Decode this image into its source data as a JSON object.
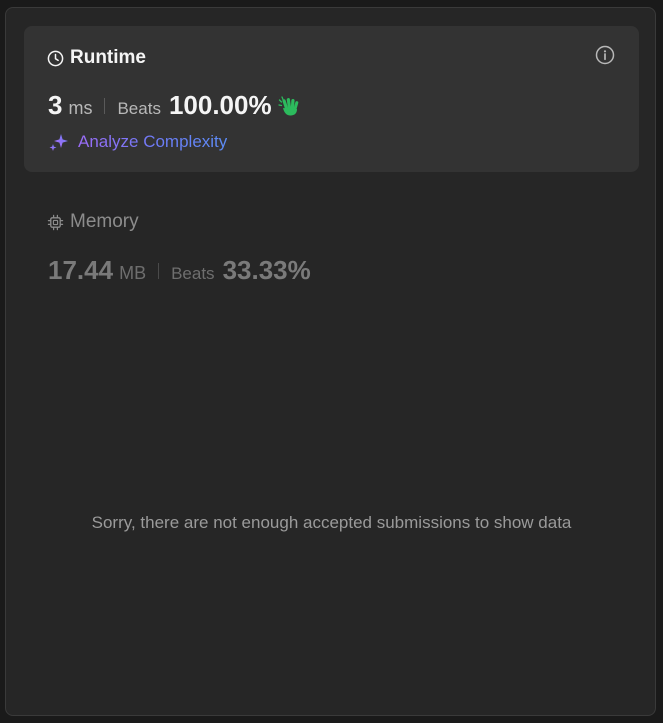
{
  "runtime": {
    "title": "Runtime",
    "value": "3",
    "unit": "ms",
    "beats_label": "Beats",
    "beats_value": "100.00%",
    "analyze_label": "Analyze Complexity"
  },
  "memory": {
    "title": "Memory",
    "value": "17.44",
    "unit": "MB",
    "beats_label": "Beats",
    "beats_value": "33.33%"
  },
  "empty_message": "Sorry, there are not enough accepted submissions to show data",
  "icons": {
    "runtime": "clock-icon",
    "info": "info-icon",
    "clap": "clap-icon",
    "analyze": "sparkle-icon",
    "memory": "chip-icon"
  },
  "colors": {
    "panel_bg": "#262626",
    "card_bg": "#333333",
    "clap_green": "#2cbb5d",
    "analyze_purple": "#9b6cf6",
    "analyze_blue": "#5c8cf6"
  }
}
